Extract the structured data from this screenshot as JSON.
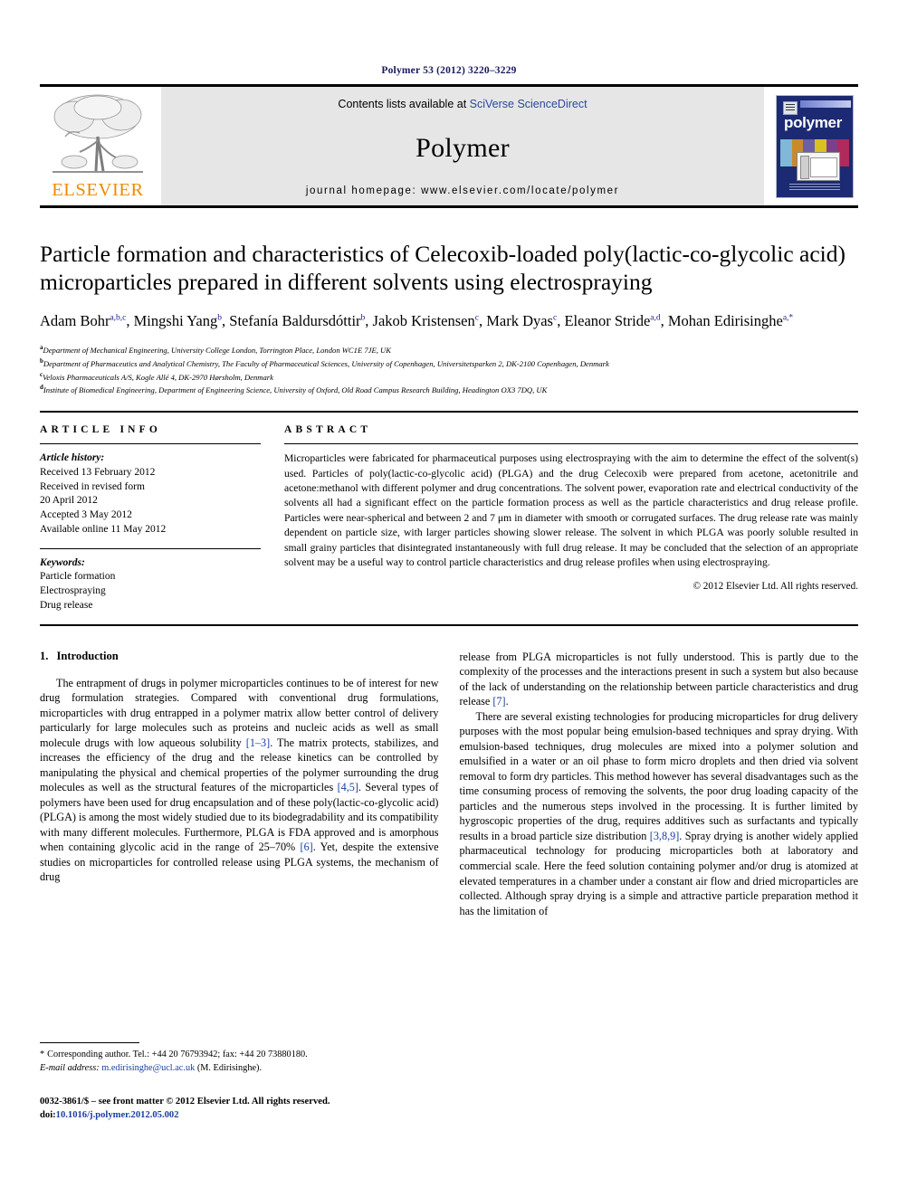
{
  "running_head": "Polymer 53 (2012) 3220–3229",
  "masthead": {
    "publisher_name": "ELSEVIER",
    "contents_prefix": "Contents lists available at ",
    "contents_link": "SciVerse ScienceDirect",
    "journal_name": "Polymer",
    "homepage_line": "journal homepage: www.elsevier.com/locate/polymer",
    "cover_title": "polymer"
  },
  "article": {
    "title": "Particle formation and characteristics of Celecoxib-loaded poly(lactic-co-glycolic acid) microparticles prepared in different solvents using electrospraying",
    "authors": [
      {
        "name": "Adam Bohr",
        "sup": "a,b,c",
        "sep": ", "
      },
      {
        "name": "Mingshi Yang",
        "sup": "b",
        "sep": ", "
      },
      {
        "name": "Stefanía Baldursdóttir",
        "sup": "b",
        "sep": ", "
      },
      {
        "name": "Jakob Kristensen",
        "sup": "c",
        "sep": ", "
      },
      {
        "name": "Mark Dyas",
        "sup": "c",
        "sep": ", "
      },
      {
        "name": "Eleanor Stride",
        "sup": "a,d",
        "sep": ", "
      },
      {
        "name": "Mohan Edirisinghe",
        "sup": "a,*",
        "sep": ""
      }
    ],
    "affiliations": [
      {
        "mark": "a",
        "text": "Department of Mechanical Engineering, University College London, Torrington Place, London WC1E 7JE, UK"
      },
      {
        "mark": "b",
        "text": "Department of Pharmaceutics and Analytical Chemistry, The Faculty of Pharmaceutical Sciences, University of Copenhagen, Universitetsparken 2, DK-2100 Copenhagen, Denmark"
      },
      {
        "mark": "c",
        "text": "Veloxis Pharmaceuticals A/S, Kogle Allé 4, DK-2970 Hørsholm, Denmark"
      },
      {
        "mark": "d",
        "text": "Institute of Biomedical Engineering, Department of Engineering Science, University of Oxford, Old Road Campus Research Building, Headington OX3 7DQ, UK"
      }
    ]
  },
  "article_info": {
    "label": "ARTICLE INFO",
    "history_label": "Article history:",
    "history": [
      "Received 13 February 2012",
      "Received in revised form",
      "20 April 2012",
      "Accepted 3 May 2012",
      "Available online 11 May 2012"
    ],
    "keywords_label": "Keywords:",
    "keywords": [
      "Particle formation",
      "Electrospraying",
      "Drug release"
    ]
  },
  "abstract": {
    "label": "ABSTRACT",
    "text": "Microparticles were fabricated for pharmaceutical purposes using electrospraying with the aim to determine the effect of the solvent(s) used. Particles of poly(lactic-co-glycolic acid) (PLGA) and the drug Celecoxib were prepared from acetone, acetonitrile and acetone:methanol with different polymer and drug concentrations. The solvent power, evaporation rate and electrical conductivity of the solvents all had a significant effect on the particle formation process as well as the particle characteristics and drug release profile. Particles were near-spherical and between 2 and 7 μm in diameter with smooth or corrugated surfaces. The drug release rate was mainly dependent on particle size, with larger particles showing slower release. The solvent in which PLGA was poorly soluble resulted in small grainy particles that disintegrated instantaneously with full drug release. It may be concluded that the selection of an appropriate solvent may be a useful way to control particle characteristics and drug release profiles when using electrospraying.",
    "copyright": "© 2012 Elsevier Ltd. All rights reserved."
  },
  "introduction": {
    "number": "1.",
    "heading": "Introduction",
    "left_para_1_a": "The entrapment of drugs in polymer microparticles continues to be of interest for new drug formulation strategies. Compared with conventional drug formulations, microparticles with drug entrapped in a polymer matrix allow better control of delivery particularly for large molecules such as proteins and nucleic acids as well as small molecule drugs with low aqueous solubility ",
    "left_ref_1": "[1–3]",
    "left_para_1_b": ". The matrix protects, stabilizes, and increases the efficiency of the drug and the release kinetics can be controlled by manipulating the physical and chemical properties of the polymer surrounding the drug molecules as well as the structural features of the microparticles ",
    "left_ref_2": "[4,5]",
    "left_para_1_c": ". Several types of polymers have been used for drug encapsulation and of these poly(lactic-co-glycolic acid) (PLGA) is among the most widely studied due to its biodegradability and its compatibility with many different molecules. Furthermore, PLGA is FDA approved and is amorphous when containing glycolic acid in the range of 25–70% ",
    "left_ref_3": "[6]",
    "left_para_1_d": ". Yet, despite the extensive studies on microparticles for controlled release using PLGA systems, the mechanism of drug",
    "right_para_1_a": "release from PLGA microparticles is not fully understood. This is partly due to the complexity of the processes and the interactions present in such a system but also because of the lack of understanding on the relationship between particle characteristics and drug release ",
    "right_ref_1": "[7]",
    "right_para_1_b": ".",
    "right_para_2_a": "There are several existing technologies for producing microparticles for drug delivery purposes with the most popular being emulsion-based techniques and spray drying. With emulsion-based techniques, drug molecules are mixed into a polymer solution and emulsified in a water or an oil phase to form micro droplets and then dried via solvent removal to form dry particles. This method however has several disadvantages such as the time consuming process of removing the solvents, the poor drug loading capacity of the particles and the numerous steps involved in the processing. It is further limited by hygroscopic properties of the drug, requires additives such as surfactants and typically results in a broad particle size distribution ",
    "right_ref_2": "[3,8,9]",
    "right_para_2_b": ". Spray drying is another widely applied pharmaceutical technology for producing microparticles both at laboratory and commercial scale. Here the feed solution containing polymer and/or drug is atomized at elevated temperatures in a chamber under a constant air flow and dried microparticles are collected. Although spray drying is a simple and attractive particle preparation method it has the limitation of"
  },
  "footer": {
    "corresponding_star": "*",
    "corresponding_text": "Corresponding author. Tel.: +44 20 76793942; fax: +44 20 73880180.",
    "email_label": "E-mail address:",
    "email": "m.edirisinghe@ucl.ac.uk",
    "email_owner": "(M. Edirisinghe).",
    "issn_line": "0032-3861/$ – see front matter © 2012 Elsevier Ltd. All rights reserved.",
    "doi_label": "doi:",
    "doi": "10.1016/j.polymer.2012.05.002"
  },
  "colors": {
    "running_head": "#1a1a5e",
    "link": "#1a3fa0",
    "elsevier_orange": "#ED8B00",
    "cover_blue": "#1b2a72",
    "band_grey": "#e6e6e6"
  }
}
